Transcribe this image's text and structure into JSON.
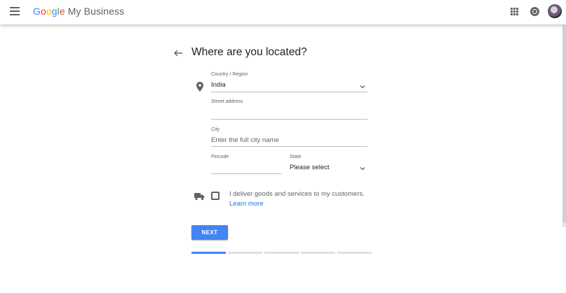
{
  "header": {
    "logo_letters": [
      "G",
      "o",
      "o",
      "g",
      "l",
      "e"
    ],
    "logo_colors": [
      "#4285f4",
      "#ea4335",
      "#fbbc05",
      "#4285f4",
      "#34a853",
      "#ea4335"
    ],
    "product_name": "My Business",
    "icons": [
      "menu-icon",
      "apps-icon",
      "notifications-icon",
      "avatar"
    ]
  },
  "form": {
    "title": "Where are you located?",
    "country": {
      "label": "Country / Region",
      "value": "India"
    },
    "street": {
      "label": "Street address",
      "value": ""
    },
    "city": {
      "label": "City",
      "placeholder": "Enter the full city name"
    },
    "pincode": {
      "label": "Pincode",
      "value": ""
    },
    "state": {
      "label": "State",
      "value": "Please select"
    },
    "delivery": {
      "label": "I deliver goods and services to my customers.",
      "link": "Learn more",
      "checked": false
    },
    "next_label": "NEXT",
    "progress": {
      "steps": 5,
      "current": 1
    }
  },
  "colors": {
    "accent": "#4285f4",
    "link": "#1a73e8"
  }
}
